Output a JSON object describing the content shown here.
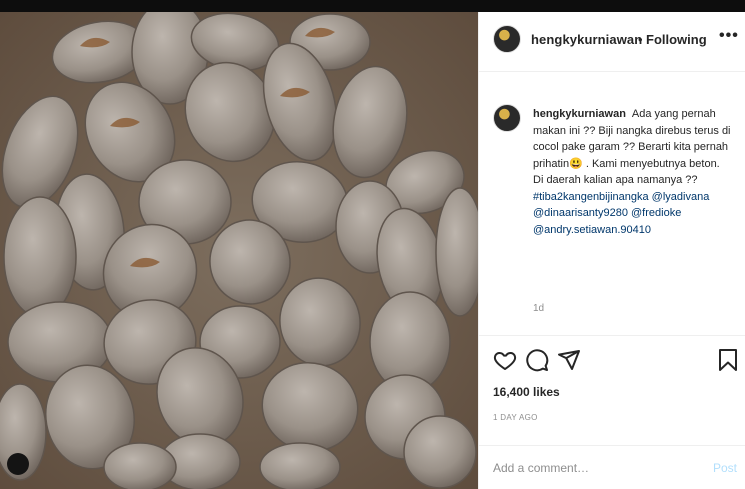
{
  "post": {
    "username": "hengkykurniawan",
    "follow_separator": "•",
    "follow_label": "Following",
    "more_label": "•••",
    "caption": {
      "username": "hengkykurniawan",
      "text": "Ada yang pernah makan ini ?? Biji nangka direbus terus di cocol pake garam ?? Berarti kita pernah prihatin😃 . Kami menyebutnya beton. Di daerah kalian apa namanya ??",
      "tags": [
        "#tiba2kangenbijinangka",
        "@lyadivana",
        "@dinaarisanty9280",
        "@fredioke",
        "@andry.setiawan.90410"
      ],
      "age": "1d"
    },
    "likes": "16,400 likes",
    "date": "1 DAY AGO",
    "comment_placeholder": "Add a comment…",
    "post_button": "Post"
  },
  "photo": {
    "subject": "boiled jackfruit seeds in a woven basket",
    "colors": {
      "background": "#7a6a58",
      "seed": "#a39a91",
      "seed_shadow": "#6c625a",
      "skin": "#8a5a32"
    }
  },
  "icons": [
    "heart-icon",
    "comment-icon",
    "share-icon",
    "bookmark-icon",
    "more-icon"
  ],
  "colors": {
    "link": "#00376b",
    "muted": "#8e8e8e",
    "post_disabled": "#b2dffc",
    "divider": "#efefef"
  }
}
